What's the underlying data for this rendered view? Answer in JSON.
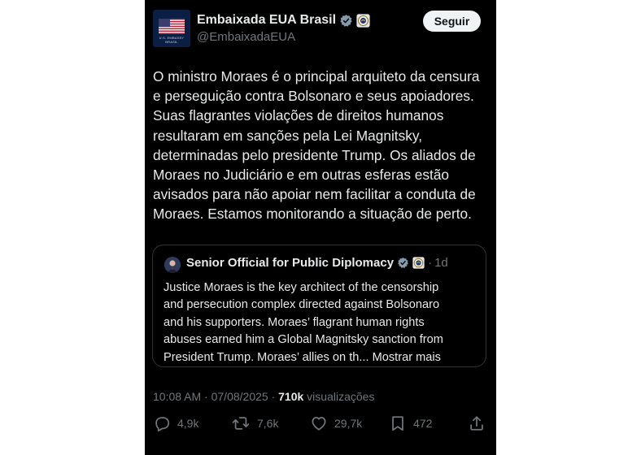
{
  "account": {
    "name": "Embaixada EUA Brasil",
    "handle": "@EmbaixadaEUA",
    "avatar_caption": "U.S. EMBASSY BRASIL",
    "follow_label": "Seguir"
  },
  "post": {
    "text": "O ministro Moraes é o principal arquiteto da censura\ne perseguição contra Bolsonaro e seus apoiadores.\nSuas flagrantes violações de direitos humanos\nresultaram em sanções pela Lei Magnitsky,\ndeterminadas pelo presidente Trump. Os aliados de\nMoraes no Judiciário e em outras esferas estão\navisados para não apoiar nem facilitar a conduta de\nMoraes. Estamos monitorando a situação de perto."
  },
  "quote": {
    "name": "Senior Official for Public Diplomacy",
    "separator": "·",
    "time": "1d",
    "text": "Justice Moraes is the key architect of the censorship\nand persecution complex directed against Bolsonaro\nand his supporters. Moraes’ flagrant human rights\nabuses earned him a Global Magnitsky sanction from\nPresident Trump. Moraes’ allies on th... ",
    "more_label": "Mostrar mais"
  },
  "meta": {
    "time": "10:08 AM",
    "separator1": " · ",
    "date": "07/08/2025",
    "separator2": " · ",
    "views_count": "710k",
    "views_label": " visualizações"
  },
  "actions": {
    "replies": "4,9k",
    "reposts": "7,6k",
    "likes": "29,7k",
    "bookmarks": "472"
  },
  "colors": {
    "background": "#000000",
    "text": "#e7e9ea",
    "muted": "#71767b",
    "verified": "#829aab",
    "border": "#2f3336"
  },
  "icons": [
    "flag-icon",
    "verified-badge-icon",
    "seal-badge-icon",
    "reply-icon",
    "repost-icon",
    "like-icon",
    "bookmark-icon",
    "share-icon"
  ]
}
